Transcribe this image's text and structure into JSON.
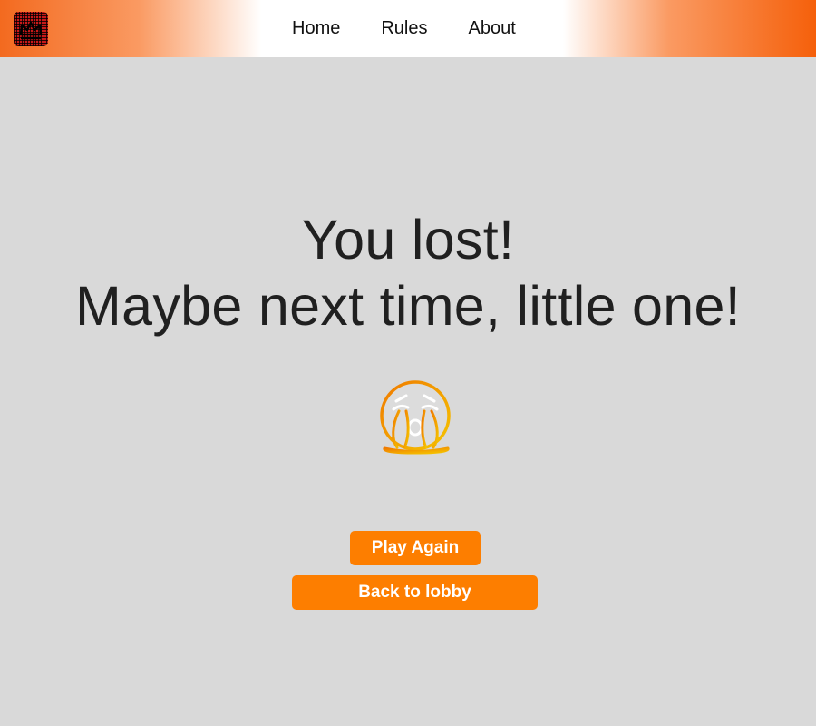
{
  "navbar": {
    "logo_icon": "crown-grid-logo",
    "links": [
      "Home",
      "Rules",
      "About"
    ],
    "gradient_colors": [
      "#f36a1f",
      "#ffffff",
      "#f5600b"
    ]
  },
  "result": {
    "line1": "You lost!",
    "line2": "Maybe next time, little one!",
    "icon": "loudly-crying-face-icon",
    "icon_colors": [
      "#f07a00",
      "#f5c400"
    ]
  },
  "actions": {
    "play_again": "Play Again",
    "back_to_lobby": "Back to lobby",
    "button_color": "#fd7e00"
  },
  "background_color": "#d9d9d9"
}
